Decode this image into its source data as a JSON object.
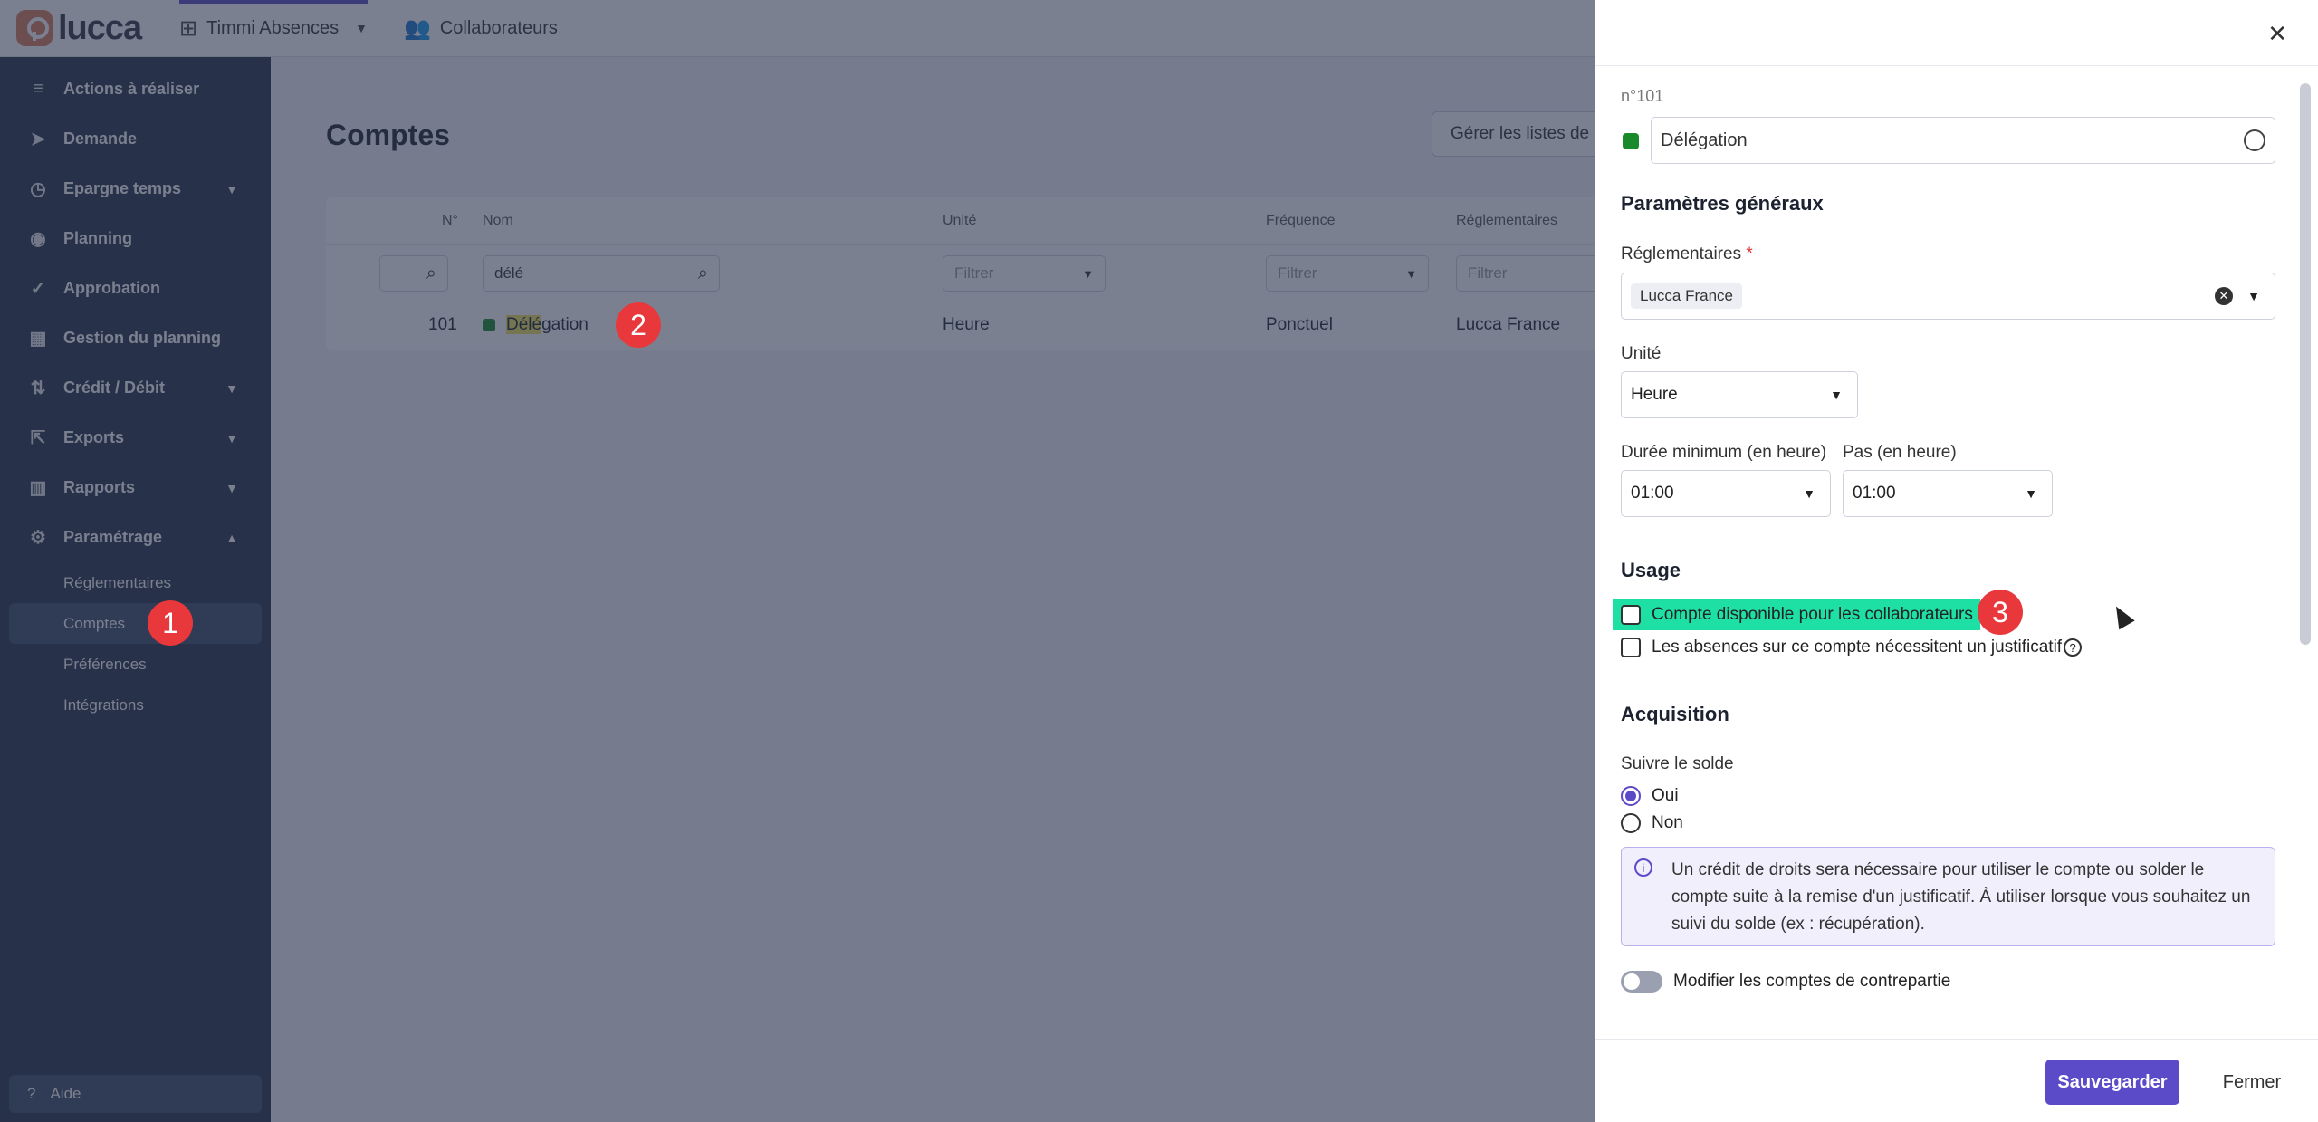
{
  "topbar": {
    "logo_text": "lucca",
    "app_label": "Timmi Absences",
    "collab_label": "Collaborateurs"
  },
  "sidebar": {
    "items": [
      {
        "label": "Actions à réaliser",
        "icon": "checklist-icon",
        "chevron": false
      },
      {
        "label": "Demande",
        "icon": "send-icon",
        "chevron": false
      },
      {
        "label": "Epargne temps",
        "icon": "clock-icon",
        "chevron": true
      },
      {
        "label": "Planning",
        "icon": "eye-icon",
        "chevron": false
      },
      {
        "label": "Approbation",
        "icon": "check-icon",
        "chevron": false
      },
      {
        "label": "Gestion du planning",
        "icon": "calendar-icon",
        "chevron": false
      },
      {
        "label": "Crédit / Débit",
        "icon": "sort-icon",
        "chevron": true
      },
      {
        "label": "Exports",
        "icon": "export-icon",
        "chevron": true
      },
      {
        "label": "Rapports",
        "icon": "chart-icon",
        "chevron": true
      },
      {
        "label": "Paramétrage",
        "icon": "settings-icon",
        "chevron": true
      }
    ],
    "sub_items": [
      "Réglementaires",
      "Comptes",
      "Préférences",
      "Intégrations"
    ],
    "help_label": "Aide"
  },
  "main": {
    "title": "Comptes",
    "manage_button": "Gérer les listes de c",
    "columns": {
      "num": "N°",
      "name": "Nom",
      "unit": "Unité",
      "freq": "Fréquence",
      "regl": "Réglementaires"
    },
    "filter_name_value": "délé",
    "filter_placeholder": "Filtrer",
    "row": {
      "num": "101",
      "name_hl": "Délé",
      "name_rest": "gation",
      "unit": "Heure",
      "freq": "Ponctuel",
      "regl": "Lucca France"
    }
  },
  "badges": {
    "b1": "1",
    "b2": "2",
    "b3": "3"
  },
  "panel": {
    "number": "n°101",
    "name_value": "Délégation",
    "section_general": "Paramètres généraux",
    "regl_label": "Réglementaires",
    "required_mark": "*",
    "regl_chip": "Lucca France",
    "unit_label": "Unité",
    "unit_value": "Heure",
    "min_label": "Durée minimum (en heure)",
    "min_value": "01:00",
    "step_label": "Pas (en heure)",
    "step_value": "01:00",
    "section_usage": "Usage",
    "cb1_label": "Compte disponible pour les collaborateurs",
    "cb2_label": "Les absences sur ce compte nécessitent un justificatif",
    "section_acq": "Acquisition",
    "follow_label": "Suivre le solde",
    "radio_yes": "Oui",
    "radio_no": "Non",
    "callout_text": "Un crédit de droits sera nécessaire pour utiliser le compte ou solder le compte suite à la remise d'un justificatif. À utiliser lorsque vous souhaitez un suivi du solde (ex : récupération).",
    "toggle_label": "Modifier les comptes de contrepartie",
    "save_label": "Sauvegarder",
    "close_label": "Fermer"
  },
  "colors": {
    "accent": "#5c4bc9",
    "sidebar": "#253048",
    "account_dot": "#198a2a",
    "highlight": "#1fe0a4",
    "badge": "#e8383c"
  }
}
